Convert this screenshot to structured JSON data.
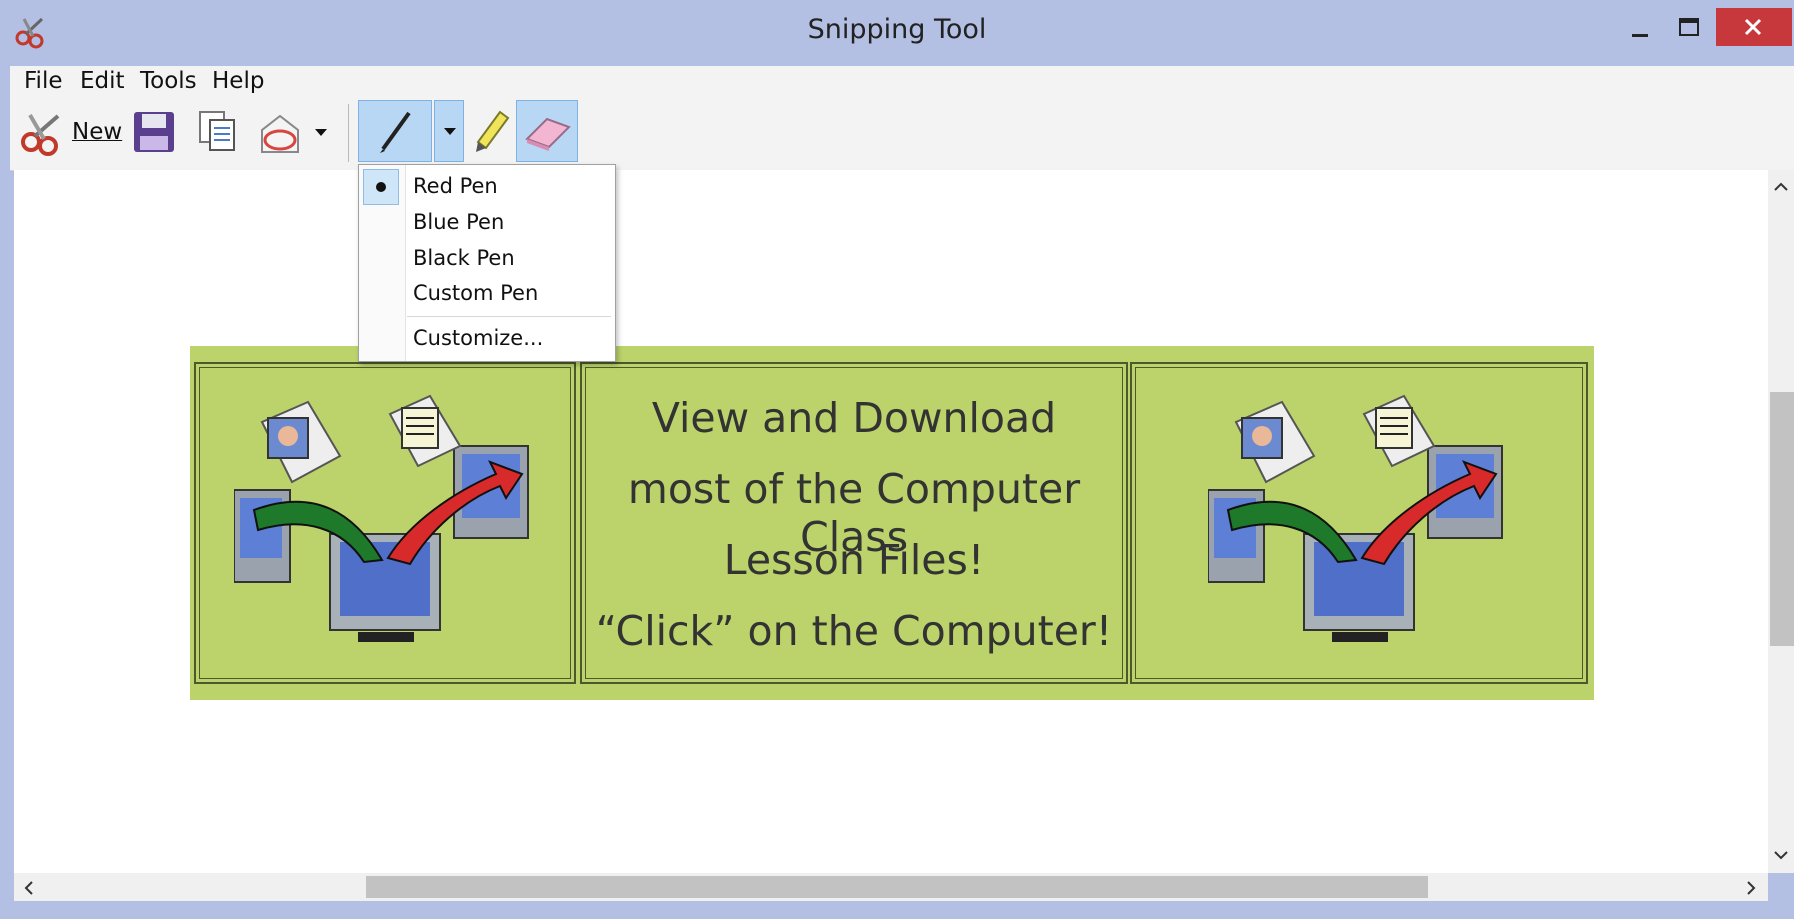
{
  "window": {
    "title": "Snipping Tool"
  },
  "menu": {
    "file": "File",
    "edit": "Edit",
    "tools": "Tools",
    "help": "Help"
  },
  "toolbar": {
    "new_label": "New"
  },
  "pen_menu": {
    "items": [
      "Red Pen",
      "Blue Pen",
      "Black Pen",
      "Custom Pen"
    ],
    "selected": "Red Pen",
    "customize": "Customize..."
  },
  "banner": {
    "line1": "View and Download",
    "line2": "most of the Computer Class",
    "line3": "Lesson Files!",
    "line4": "“Click” on the Computer!"
  },
  "colors": {
    "titlebar": "#b3bfe3",
    "close_button": "#c7383c",
    "banner_bg": "#bcd36b",
    "selected_tool": "#b7d7f4"
  },
  "icons": [
    "scissors-icon",
    "save-icon",
    "copy-icon",
    "send-email-icon",
    "pen-icon",
    "highlighter-icon",
    "eraser-icon",
    "minimize-icon",
    "maximize-icon",
    "close-icon"
  ]
}
